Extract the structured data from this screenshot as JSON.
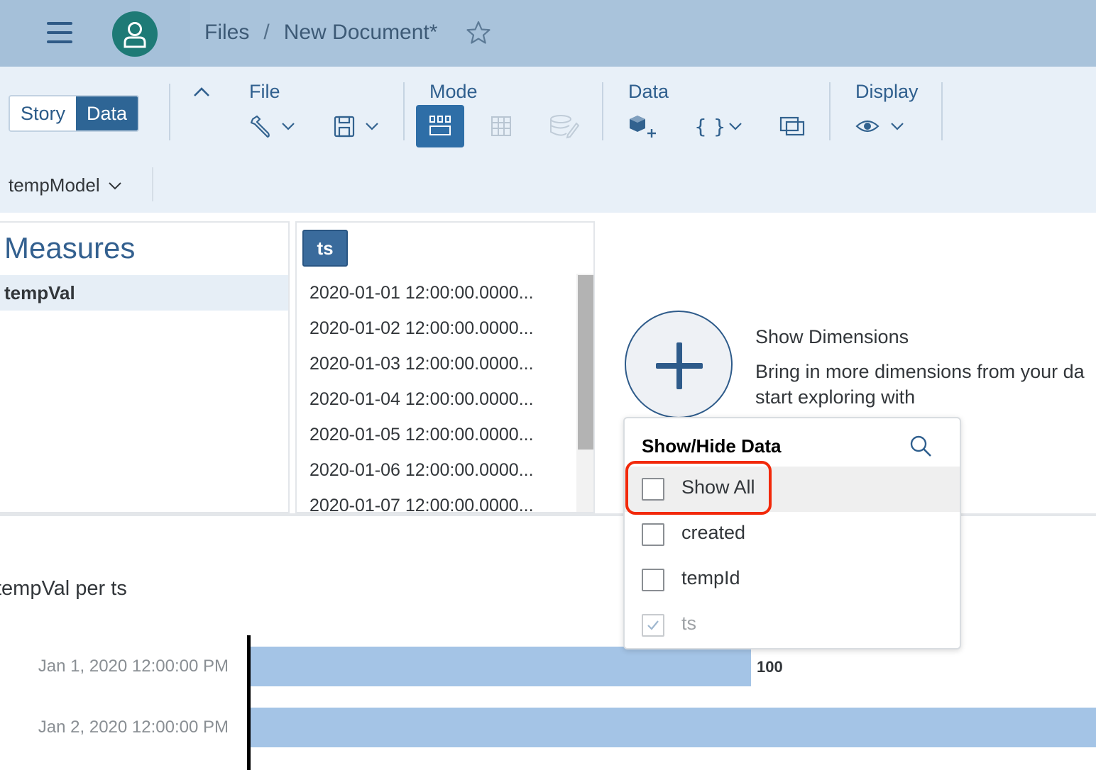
{
  "shell": {
    "breadcrumb_root": "Files",
    "breadcrumb_separator": "/",
    "document_title": "New Document*"
  },
  "toolbar": {
    "story_label": "Story",
    "data_label": "Data",
    "groups": {
      "file": "File",
      "mode": "Mode",
      "data": "Data",
      "display": "Display"
    },
    "model_name": "tempModel"
  },
  "measures": {
    "title": "Measures",
    "items": [
      "tempVal"
    ]
  },
  "column": {
    "header": "ts",
    "cells": [
      "2020-01-01 12:00:00.0000...",
      "2020-01-02 12:00:00.0000...",
      "2020-01-03 12:00:00.0000...",
      "2020-01-04 12:00:00.0000...",
      "2020-01-05 12:00:00.0000...",
      "2020-01-06 12:00:00.0000...",
      "2020-01-07 12:00:00.0000..."
    ]
  },
  "dimensions": {
    "title": "Show Dimensions",
    "description": "Bring in more dimensions from your da start exploring with"
  },
  "popover": {
    "title": "Show/Hide Data",
    "options": [
      {
        "label": "Show All",
        "checked": false,
        "disabled": false
      },
      {
        "label": "created",
        "checked": false,
        "disabled": false
      },
      {
        "label": "tempId",
        "checked": false,
        "disabled": false
      },
      {
        "label": "ts",
        "checked": true,
        "disabled": true
      }
    ]
  },
  "chart_data": {
    "type": "bar",
    "title": "tempVal per ts",
    "categories": [
      "Jan 1, 2020 12:00:00 PM",
      "Jan 2, 2020 12:00:00 PM"
    ],
    "values": [
      100,
      170
    ],
    "data_labels": [
      "100",
      ""
    ],
    "colors": {
      "bar": "#a4c4e6"
    }
  },
  "colors": {
    "shellbar": "#a9c3db",
    "toolbar_bg": "#e8f0f8",
    "accent": "#2e6595",
    "highlight_ring": "#f2290a"
  }
}
